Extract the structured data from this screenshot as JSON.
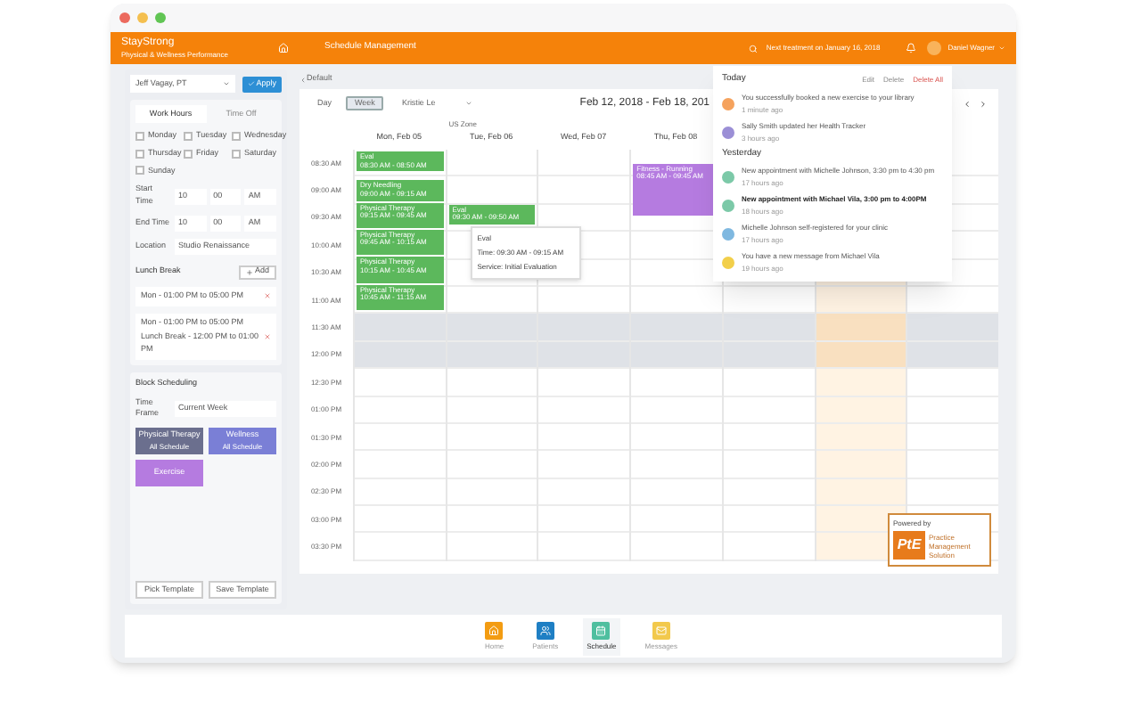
{
  "window": {
    "controls": [
      {
        "color": "#ec6a5e"
      },
      {
        "color": "#f4bf4f"
      },
      {
        "color": "#61c554"
      }
    ]
  },
  "header": {
    "logo": "StayStrong",
    "tagline": "Physical & Wellness Performance",
    "title": "Schedule Management",
    "next_appointment": "Next treatment on January 16, 2018",
    "user": "Daniel Wagner"
  },
  "sidebar": {
    "provider": "Jeff Vagay, PT",
    "apply": "Apply",
    "tabs": [
      {
        "label": "Work Hours",
        "selected": true
      },
      {
        "label": "Time Off",
        "selected": false
      }
    ],
    "days": [
      {
        "label": "Monday",
        "checked": false
      },
      {
        "label": "Tuesday",
        "checked": false
      },
      {
        "label": "Wednesday",
        "checked": false
      },
      {
        "label": "Thursday",
        "checked": false
      },
      {
        "label": "Friday",
        "checked": false
      },
      {
        "label": "Saturday",
        "checked": false
      },
      {
        "label": "Sunday",
        "checked": false
      }
    ],
    "times": [
      {
        "label": "Start Time",
        "hour": "10",
        "minute": "00",
        "period": "AM"
      },
      {
        "label": "End Time",
        "hour": "10",
        "minute": "00",
        "period": "AM"
      }
    ],
    "location": {
      "label": "Location",
      "value": "Studio Renaissance"
    },
    "lunch": {
      "title": "Lunch Break",
      "add": "Add",
      "entries": [
        {
          "lines": [
            "Mon - 01:00 PM to 05:00 PM"
          ]
        },
        {
          "lines": [
            "Mon - 01:00 PM to 05:00 PM",
            "Lunch Break - 12:00 PM to 01:00 PM"
          ]
        }
      ]
    },
    "block_scheduling": {
      "title": "Block Scheduling",
      "time_frame": {
        "label": "Time Frame",
        "value": "Current Week"
      },
      "blocks": [
        {
          "title": "Physical Therapy",
          "subtitle": "All Schedule",
          "color": "#6b6f8e"
        },
        {
          "title": "Wellness",
          "subtitle": "All Schedule",
          "color": "#7a7fd6"
        },
        {
          "title": "Exercise",
          "color": "#b57be0"
        }
      ]
    },
    "buttons": [
      "Pick Template",
      "Save Template"
    ]
  },
  "calendar": {
    "back_link": "Default",
    "views": [
      {
        "label": "Day",
        "selected": false
      },
      {
        "label": "Week",
        "selected": true
      }
    ],
    "provider": "Kristie Le",
    "range": "Feb 12, 2018 - Feb 18, 201",
    "timezone": "US Zone",
    "time_slots": [
      {
        "label": "08:30 AM",
        "shaded": false
      },
      {
        "label": "09:00 AM",
        "shaded": false
      },
      {
        "label": "09:30 AM",
        "shaded": false
      },
      {
        "label": "10:00 AM",
        "shaded": false
      },
      {
        "label": "10:30 AM",
        "shaded": false
      },
      {
        "label": "11:00 AM",
        "shaded": false
      },
      {
        "label": "11:30 AM",
        "shaded": true
      },
      {
        "label": "12:00 PM",
        "shaded": true
      },
      {
        "label": "12:30 PM",
        "shaded": false
      },
      {
        "label": "01:00 PM",
        "shaded": false
      },
      {
        "label": "01:30 PM",
        "shaded": false
      },
      {
        "label": "02:00 PM",
        "shaded": false
      },
      {
        "label": "02:30 PM",
        "shaded": false
      },
      {
        "label": "03:00 PM",
        "shaded": false
      },
      {
        "label": "03:30 PM",
        "shaded": false
      }
    ],
    "days": [
      {
        "label": "Mon, Feb 05",
        "highlighted": false,
        "events": [
          {
            "title": "Eval",
            "time": "08:30 AM - 08:50 AM",
            "color": "#5cb85c"
          },
          {
            "title": "Dry Needling",
            "time": "09:00 AM - 09:15 AM",
            "color": "#5cb85c"
          },
          {
            "title": "Physical Therapy",
            "time": "09:15 AM - 09:45 AM",
            "color": "#5cb85c"
          },
          {
            "title": "Physical Therapy",
            "time": "09:45 AM - 10:15 AM",
            "color": "#5cb85c"
          },
          {
            "title": "Physical Therapy",
            "time": "10:15 AM - 10:45 AM",
            "color": "#5cb85c"
          },
          {
            "title": "Physical Therapy",
            "time": "10:45 AM - 11:15 AM",
            "color": "#5cb85c"
          }
        ]
      },
      {
        "label": "Tue, Feb 06",
        "highlighted": false,
        "events": [
          {
            "title": "Eval",
            "time": "09:30 AM - 09:50 AM",
            "color": "#5cb85c",
            "tooltip": {
              "title": "Eval",
              "time": "Time: 09:30 AM - 09:15 AM",
              "service": "Service: Initial Evaluation"
            }
          }
        ]
      },
      {
        "label": "Wed, Feb 07",
        "highlighted": false
      },
      {
        "label": "Thu, Feb 08",
        "highlighted": false,
        "events": [
          {
            "title": "Fitness - Running",
            "time": "08:45 AM - 09:45 AM",
            "color": "#b57be0"
          }
        ]
      },
      {
        "highlighted": false
      },
      {
        "highlighted": true
      },
      {
        "highlighted": false
      }
    ]
  },
  "notifications": {
    "actions": [
      "Edit",
      "Delete",
      "Delete All"
    ],
    "groups": [
      {
        "title": "Today",
        "items": [
          {
            "text": "You successfully booked a new exercise to your library",
            "time": "1 minute ago",
            "color": "#f5a25d",
            "unread": false
          },
          {
            "text": "Sally Smith updated her Health Tracker",
            "time": "3 hours ago",
            "color": "#9b8fd6",
            "unread": false
          }
        ]
      },
      {
        "title": "Yesterday",
        "items": [
          {
            "text": "New appointment with Michelle Johnson, 3:30 pm to 4:30 pm",
            "time": "17 hours ago",
            "color": "#7cc9a8",
            "unread": false
          },
          {
            "text": "New appointment with Michael Vila, 3:00 pm to 4:00PM",
            "time": "18 hours ago",
            "color": "#7cc9a8",
            "unread": true
          },
          {
            "text": "Michelle Johnson self-registered for your clinic",
            "time": "17 hours ago",
            "color": "#7fb8e0",
            "unread": false
          },
          {
            "text": "You have a new message from Michael Vila",
            "time": "19 hours ago",
            "color": "#f2cf4a",
            "unread": false
          }
        ]
      }
    ]
  },
  "powered_by": {
    "caption": "Powered by",
    "logo": "PtE",
    "name": "Practice Management Solution"
  },
  "bottom_nav": [
    {
      "kind": "home",
      "label": "Home",
      "color": "#f39c12",
      "selected": false
    },
    {
      "kind": "patients",
      "label": "Patients",
      "color": "#1f7fc4",
      "selected": false
    },
    {
      "kind": "schedule",
      "label": "Schedule",
      "color": "#4fbf9f",
      "selected": true
    },
    {
      "kind": "messages",
      "label": "Messages",
      "color": "#f2c94c",
      "selected": false
    }
  ]
}
